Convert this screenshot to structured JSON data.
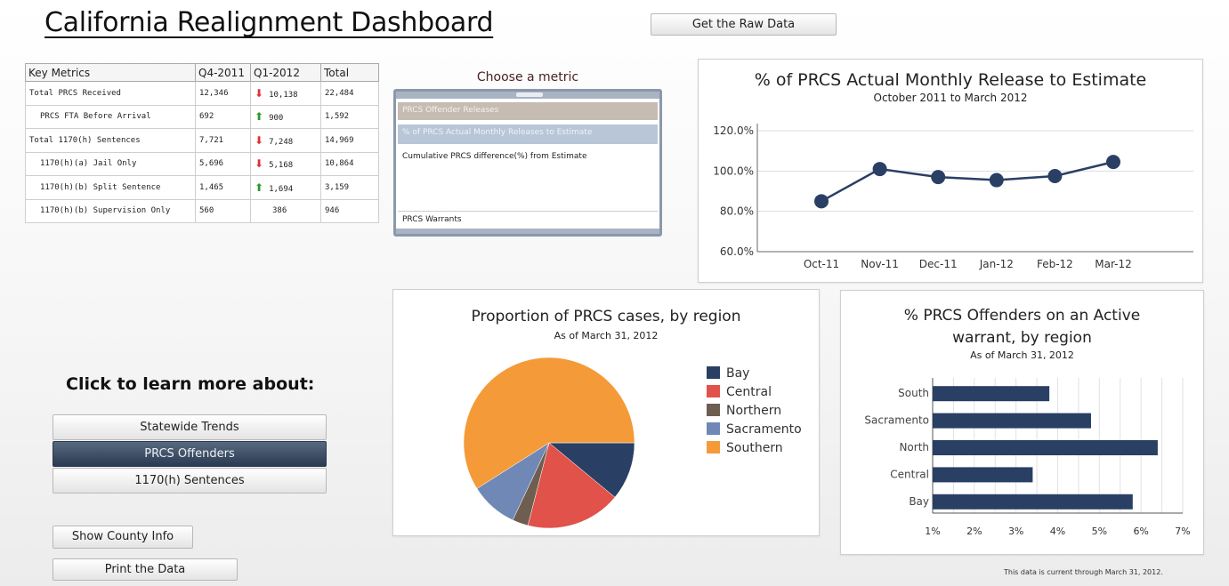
{
  "page": {
    "title": "California Realignment Dashboard",
    "footnote": "This data is current through March 31, 2012."
  },
  "toolbar": {
    "raw_data_label": "Get the Raw Data"
  },
  "key_metrics": {
    "headers": [
      "Key Metrics",
      "Q4-2011",
      "Q1-2012",
      "Total"
    ],
    "rows": [
      {
        "label": "Total PRCS Received",
        "q4": "12,346",
        "trend": "down",
        "q1": "10,138",
        "total": "22,484"
      },
      {
        "label": "PRCS FTA Before Arrival",
        "q4": "692",
        "trend": "up",
        "q1": "900",
        "total": "1,592"
      },
      {
        "label": "Total 1170(h) Sentences",
        "q4": "7,721",
        "trend": "down",
        "q1": "7,248",
        "total": "14,969"
      },
      {
        "label": "1170(h)(a) Jail Only",
        "q4": "5,696",
        "trend": "down",
        "q1": "5,168",
        "total": "10,864"
      },
      {
        "label": "1170(h)(b) Split Sentence",
        "q4": "1,465",
        "trend": "up",
        "q1": "1,694",
        "total": "3,159"
      },
      {
        "label": "1170(h)(b) Supervision Only",
        "q4": "560",
        "trend": "none",
        "q1": "386",
        "total": "946"
      }
    ]
  },
  "metric_chooser": {
    "title": "Choose a metric",
    "options": [
      "PRCS Offender Releases",
      "% of PRCS Actual Monthly Releases to Estimate",
      "Cumulative PRCS difference(%) from Estimate",
      "PRCS Warrants"
    ],
    "selected_index": 1
  },
  "learn_more": {
    "heading": "Click to learn more about:",
    "buttons": [
      "Statewide Trends",
      "PRCS Offenders",
      "1170(h) Sentences"
    ],
    "selected_index": 1
  },
  "actions": {
    "show_county_label": "Show County Info",
    "print_label": "Print the Data"
  },
  "colors": {
    "navy": "#2a3f64",
    "selected_button": "#2a3a52",
    "down_arrow": "#dd3333",
    "up_arrow": "#2a9a2a"
  },
  "chart_data": [
    {
      "type": "line",
      "title": "% of PRCS Actual Monthly Release to Estimate",
      "subtitle": "October 2011 to March 2012",
      "x": [
        "Oct-11",
        "Nov-11",
        "Dec-11",
        "Jan-12",
        "Feb-12",
        "Mar-12"
      ],
      "values": [
        85,
        101,
        97,
        95.5,
        97.5,
        104.5
      ],
      "yticks": [
        "60.0%",
        "80.0%",
        "100.0%",
        "120.0%"
      ],
      "ylim": [
        60,
        120
      ],
      "color": "#2a3f64",
      "grid": true
    },
    {
      "type": "pie",
      "title": "Proportion of PRCS cases, by region",
      "subtitle": "As of March 31, 2012",
      "legend_position": "right",
      "slices": [
        {
          "name": "Bay",
          "value": 11,
          "color": "#2a3f64"
        },
        {
          "name": "Central",
          "value": 18,
          "color": "#e0524a"
        },
        {
          "name": "Northern",
          "value": 3,
          "color": "#6e5e50"
        },
        {
          "name": "Sacramento",
          "value": 9,
          "color": "#6f88b6"
        },
        {
          "name": "Southern",
          "value": 59,
          "color": "#f49a38"
        }
      ]
    },
    {
      "type": "bar",
      "orientation": "horizontal",
      "title_lines": [
        "% PRCS Offenders on an Active",
        "warrant, by region"
      ],
      "subtitle": "As of March 31, 2012",
      "categories": [
        "South",
        "Sacramento",
        "North",
        "Central",
        "Bay"
      ],
      "values": [
        3.8,
        4.8,
        6.4,
        3.4,
        5.8
      ],
      "xticks": [
        "1%",
        "2%",
        "3%",
        "4%",
        "5%",
        "6%",
        "7%"
      ],
      "xlim": [
        1,
        7
      ],
      "color": "#2a3f64"
    }
  ]
}
